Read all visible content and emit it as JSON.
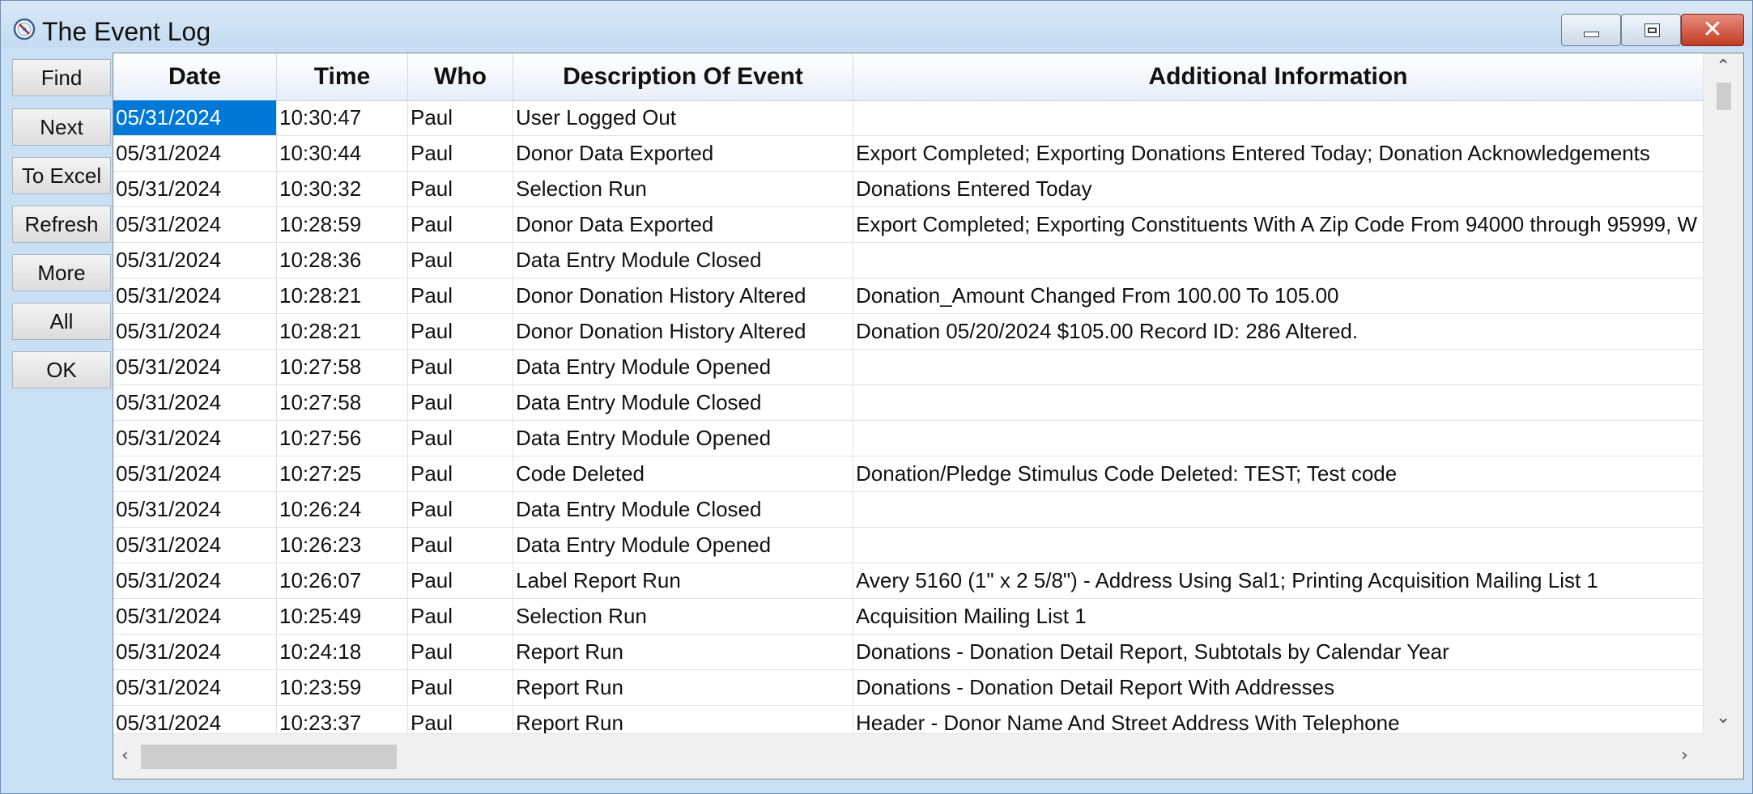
{
  "window": {
    "title": "The Event Log",
    "icon": "compass-icon"
  },
  "sidebar": {
    "buttons": [
      "Find",
      "Next",
      "To Excel",
      "Refresh",
      "More",
      "All",
      "OK"
    ]
  },
  "grid": {
    "columns": [
      "Date",
      "Time",
      "Who",
      "Description Of Event",
      "Additional Information"
    ],
    "selected_cell": {
      "row": 0,
      "column": 0
    },
    "rows": [
      [
        "05/31/2024",
        "10:30:47",
        "Paul",
        "User Logged Out",
        ""
      ],
      [
        "05/31/2024",
        "10:30:44",
        "Paul",
        "Donor Data Exported",
        "Export Completed; Exporting Donations Entered Today; Donation Acknowledgements"
      ],
      [
        "05/31/2024",
        "10:30:32",
        "Paul",
        "Selection Run",
        "Donations Entered Today"
      ],
      [
        "05/31/2024",
        "10:28:59",
        "Paul",
        "Donor Data Exported",
        "Export Completed; Exporting Constituents With A Zip Code From 94000 through 95999, W"
      ],
      [
        "05/31/2024",
        "10:28:36",
        "Paul",
        "Data Entry Module Closed",
        ""
      ],
      [
        "05/31/2024",
        "10:28:21",
        "Paul",
        "Donor Donation History Altered",
        "Donation_Amount Changed From 100.00 To 105.00"
      ],
      [
        "05/31/2024",
        "10:28:21",
        "Paul",
        "Donor Donation History Altered",
        "Donation 05/20/2024 $105.00 Record ID: 286 Altered."
      ],
      [
        "05/31/2024",
        "10:27:58",
        "Paul",
        "Data Entry Module Opened",
        ""
      ],
      [
        "05/31/2024",
        "10:27:58",
        "Paul",
        "Data Entry Module Closed",
        ""
      ],
      [
        "05/31/2024",
        "10:27:56",
        "Paul",
        "Data Entry Module Opened",
        ""
      ],
      [
        "05/31/2024",
        "10:27:25",
        "Paul",
        "Code Deleted",
        "Donation/Pledge Stimulus Code Deleted: TEST; Test code"
      ],
      [
        "05/31/2024",
        "10:26:24",
        "Paul",
        "Data Entry Module Closed",
        ""
      ],
      [
        "05/31/2024",
        "10:26:23",
        "Paul",
        "Data Entry Module Opened",
        ""
      ],
      [
        "05/31/2024",
        "10:26:07",
        "Paul",
        "Label Report Run",
        "Avery 5160 (1\" x 2 5/8\") - Address Using Sal1; Printing Acquisition Mailing List 1"
      ],
      [
        "05/31/2024",
        "10:25:49",
        "Paul",
        "Selection Run",
        "Acquisition Mailing List 1"
      ],
      [
        "05/31/2024",
        "10:24:18",
        "Paul",
        "Report Run",
        "Donations - Donation Detail Report, Subtotals by Calendar Year"
      ],
      [
        "05/31/2024",
        "10:23:59",
        "Paul",
        "Report Run",
        "Donations - Donation Detail Report With Addresses"
      ],
      [
        "05/31/2024",
        "10:23:37",
        "Paul",
        "Report Run",
        "Header - Donor Name And Street Address With Telephone"
      ],
      [
        "",
        "",
        "",
        "",
        ""
      ]
    ]
  },
  "colors": {
    "selection": "#0078d7",
    "window_frame": "#c9dff3",
    "close_button": "#c23b22"
  }
}
